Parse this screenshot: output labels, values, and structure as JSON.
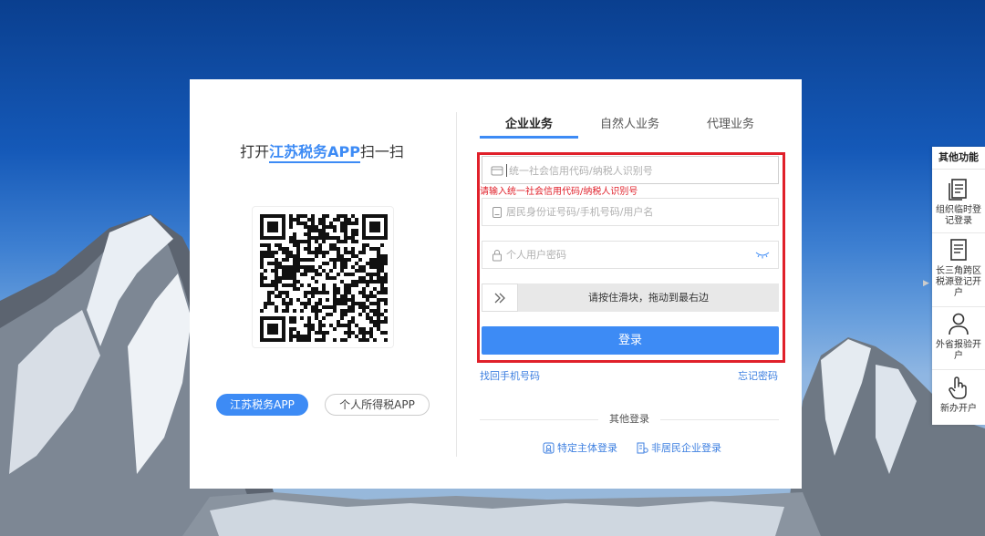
{
  "qr_panel": {
    "title_prefix": "打开",
    "title_highlight": "江苏税务APP",
    "title_suffix": "扫一扫",
    "apps": [
      {
        "label": "江苏税务APP",
        "active": true
      },
      {
        "label": "个人所得税APP",
        "active": false
      }
    ]
  },
  "tabs": [
    {
      "label": "企业业务",
      "active": true
    },
    {
      "label": "自然人业务",
      "active": false
    },
    {
      "label": "代理业务",
      "active": false
    }
  ],
  "form": {
    "credit_code_placeholder": "统一社会信用代码/纳税人识别号",
    "credit_code_error": "请输入统一社会信用代码/纳税人识别号",
    "id_placeholder": "居民身份证号码/手机号码/用户名",
    "password_placeholder": "个人用户密码",
    "slider_text": "请按住滑块，拖动到最右边",
    "login_label": "登录",
    "recover_phone_link": "找回手机号码",
    "forgot_password_link": "忘记密码",
    "other_login_label": "其他登录",
    "special_entity_login": "特定主体登录",
    "nonresident_login": "非居民企业登录"
  },
  "side_panel": {
    "title": "其他功能",
    "items": [
      {
        "label": "组织临时登记登录",
        "icon": "document-icon"
      },
      {
        "label": "长三角跨区税源登记开户",
        "icon": "list-icon"
      },
      {
        "label": "外省报验开户",
        "icon": "user-icon"
      },
      {
        "label": "新办开户",
        "icon": "hand-pointer-icon"
      }
    ]
  },
  "colors": {
    "accent": "#3d8bf5",
    "error": "#e0202a",
    "highlight_frame": "#e0202a"
  }
}
